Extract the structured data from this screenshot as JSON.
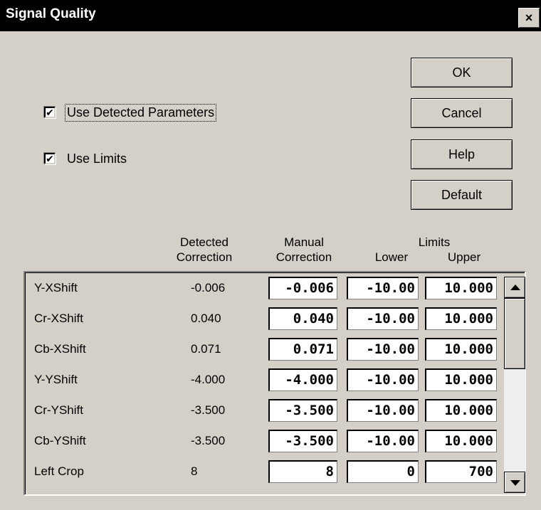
{
  "window": {
    "title": "Signal Quality",
    "close_label": "×"
  },
  "options": {
    "use_detected": {
      "label": "Use Detected Parameters",
      "checked": true,
      "mark": "✔"
    },
    "use_limits": {
      "label": "Use Limits",
      "checked": true,
      "mark": "✔"
    }
  },
  "buttons": {
    "ok": "OK",
    "cancel": "Cancel",
    "help": "Help",
    "default": "Default"
  },
  "columns": {
    "detected_line1": "Detected",
    "detected_line2": "Correction",
    "manual_line1": "Manual",
    "manual_line2": "Correction",
    "limits": "Limits",
    "lower": "Lower",
    "upper": "Upper"
  },
  "rows": [
    {
      "name": "Y-XShift",
      "detected": "-0.006",
      "manual": "-0.006",
      "lower": "-10.00",
      "upper": "10.000"
    },
    {
      "name": "Cr-XShift",
      "detected": "0.040",
      "manual": "0.040",
      "lower": "-10.00",
      "upper": "10.000"
    },
    {
      "name": "Cb-XShift",
      "detected": "0.071",
      "manual": "0.071",
      "lower": "-10.00",
      "upper": "10.000"
    },
    {
      "name": "Y-YShift",
      "detected": "-4.000",
      "manual": "-4.000",
      "lower": "-10.00",
      "upper": "10.000"
    },
    {
      "name": "Cr-YShift",
      "detected": "-3.500",
      "manual": "-3.500",
      "lower": "-10.00",
      "upper": "10.000"
    },
    {
      "name": "Cb-YShift",
      "detected": "-3.500",
      "manual": "-3.500",
      "lower": "-10.00",
      "upper": "10.000"
    },
    {
      "name": "Left Crop",
      "detected": "8",
      "manual": "8",
      "lower": "0",
      "upper": "700"
    }
  ],
  "colors": {
    "face": "#d4d0c8",
    "titlebar": "#000000",
    "field": "#ffffff"
  }
}
